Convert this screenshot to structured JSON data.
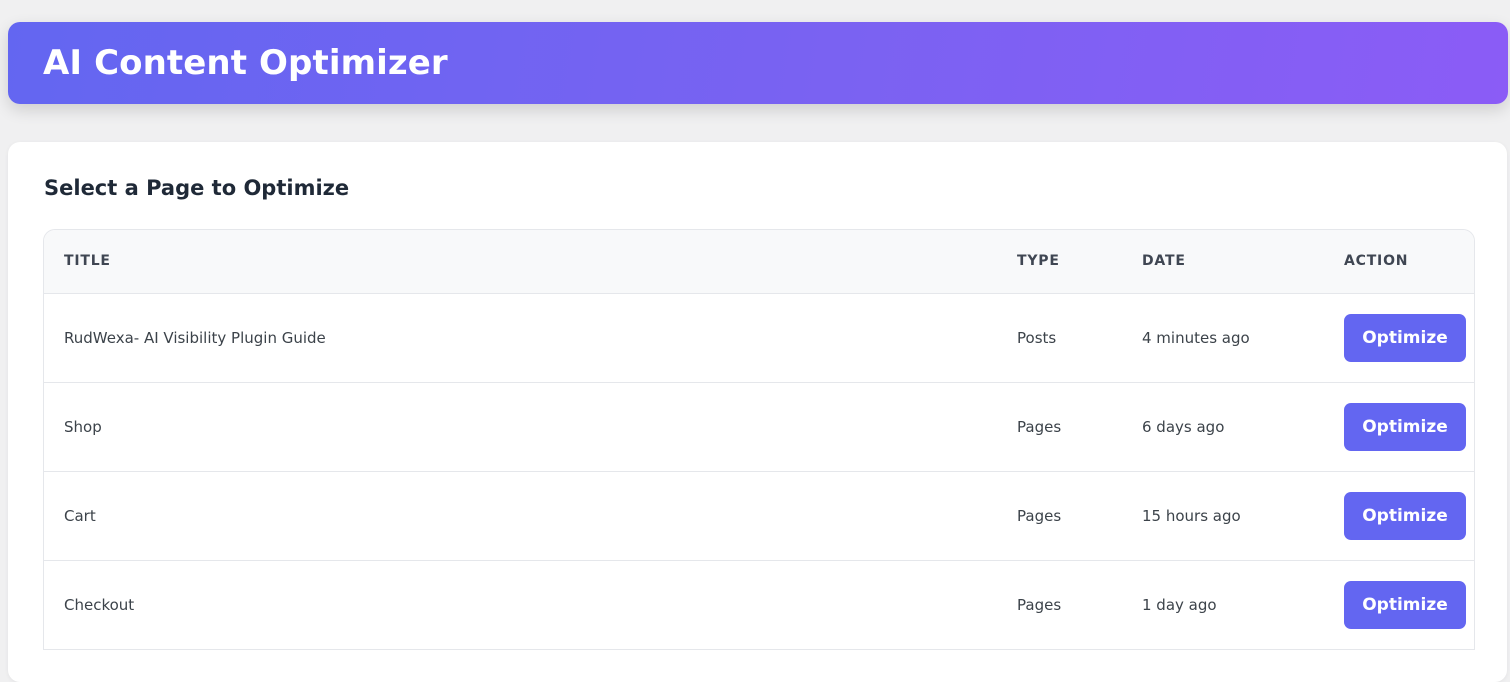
{
  "header": {
    "title": "AI Content Optimizer"
  },
  "main": {
    "section_title": "Select a Page to Optimize",
    "table": {
      "columns": [
        "TITLE",
        "TYPE",
        "DATE",
        "ACTION"
      ],
      "rows": [
        {
          "title": "RudWexa- AI Visibility Plugin Guide",
          "type": "Posts",
          "date": "4 minutes ago",
          "action_label": "Optimize"
        },
        {
          "title": "Shop",
          "type": "Pages",
          "date": "6 days ago",
          "action_label": "Optimize"
        },
        {
          "title": "Cart",
          "type": "Pages",
          "date": "15 hours ago",
          "action_label": "Optimize"
        },
        {
          "title": "Checkout",
          "type": "Pages",
          "date": "1 day ago",
          "action_label": "Optimize"
        }
      ]
    }
  },
  "colors": {
    "accent": "#6366f1",
    "header_gradient_end": "#8b5cf6"
  }
}
